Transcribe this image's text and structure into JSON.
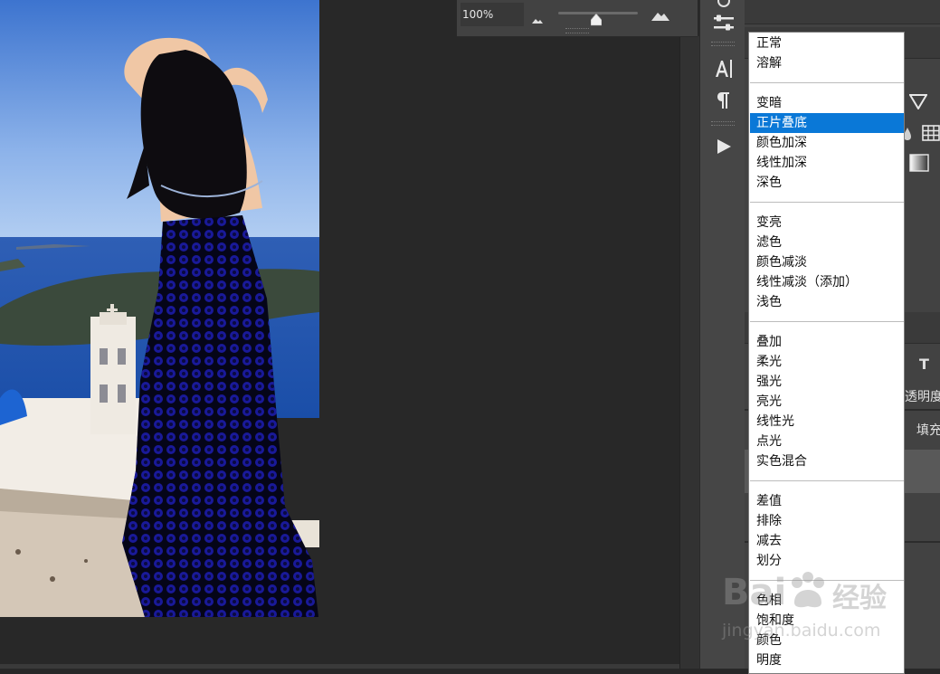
{
  "navigator": {
    "zoom_value": "100%",
    "zoom": 1.0
  },
  "tools": {
    "character_icon": "character-panel-icon",
    "paragraph_icon": "paragraph-icon",
    "play_icon": "play-action-icon",
    "adjust_icon": "adjustments-icon"
  },
  "right_panel": {
    "opacity_label": "透明度",
    "fill_label": "填充",
    "type_icon_label": "T"
  },
  "blend_menu": {
    "selected": "正片叠底",
    "groups": [
      [
        "正常",
        "溶解"
      ],
      [
        "变暗",
        "正片叠底",
        "颜色加深",
        "线性加深",
        "深色"
      ],
      [
        "变亮",
        "滤色",
        "颜色减淡",
        "线性减淡（添加）",
        "浅色"
      ],
      [
        "叠加",
        "柔光",
        "强光",
        "亮光",
        "线性光",
        "点光",
        "实色混合"
      ],
      [
        "差值",
        "排除",
        "减去",
        "划分"
      ],
      [
        "色相",
        "饱和度",
        "颜色",
        "明度"
      ]
    ]
  },
  "watermark": {
    "brand": "Bai",
    "name": "经验",
    "url": "jingyan.baidu.com"
  },
  "colors": {
    "selection": "#0a78d7",
    "dress_blue": "#1a1aa8"
  }
}
